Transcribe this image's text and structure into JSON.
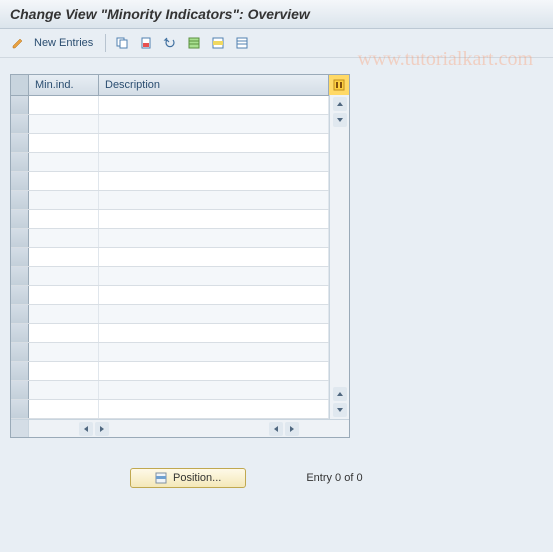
{
  "header": {
    "title": "Change View \"Minority Indicators\": Overview"
  },
  "toolbar": {
    "new_entries_label": "New Entries",
    "icons": [
      "edit",
      "copy",
      "delete",
      "undo",
      "select-all",
      "select-block",
      "deselect-all"
    ]
  },
  "watermark": "www.tutorialkart.com",
  "table": {
    "columns": {
      "min_ind": "Min.ind.",
      "description": "Description"
    },
    "rows": [
      {
        "min_ind": "",
        "description": ""
      },
      {
        "min_ind": "",
        "description": ""
      },
      {
        "min_ind": "",
        "description": ""
      },
      {
        "min_ind": "",
        "description": ""
      },
      {
        "min_ind": "",
        "description": ""
      },
      {
        "min_ind": "",
        "description": ""
      },
      {
        "min_ind": "",
        "description": ""
      },
      {
        "min_ind": "",
        "description": ""
      },
      {
        "min_ind": "",
        "description": ""
      },
      {
        "min_ind": "",
        "description": ""
      },
      {
        "min_ind": "",
        "description": ""
      },
      {
        "min_ind": "",
        "description": ""
      },
      {
        "min_ind": "",
        "description": ""
      },
      {
        "min_ind": "",
        "description": ""
      },
      {
        "min_ind": "",
        "description": ""
      },
      {
        "min_ind": "",
        "description": ""
      },
      {
        "min_ind": "",
        "description": ""
      }
    ]
  },
  "footer": {
    "position_label": "Position...",
    "entry_text": "Entry 0 of 0"
  }
}
